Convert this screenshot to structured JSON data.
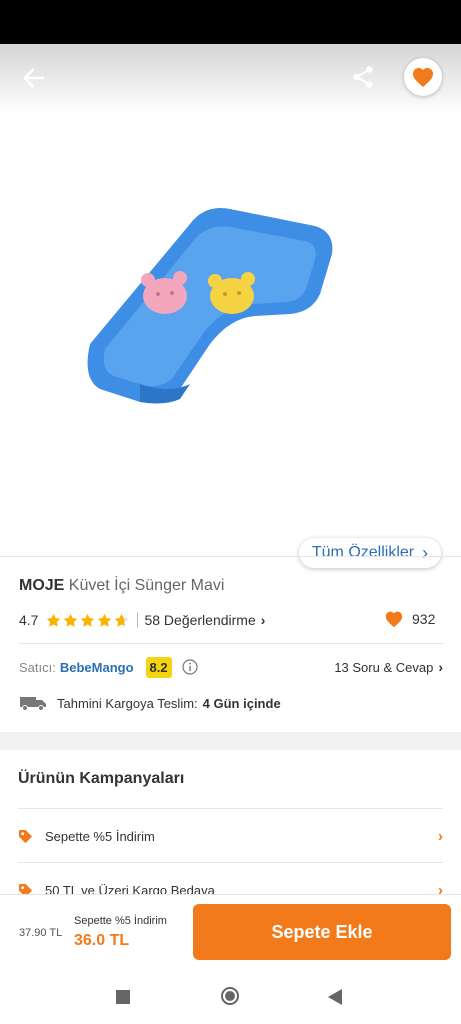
{
  "header": {
    "back_icon": "arrow-left-icon",
    "share_icon": "share-icon",
    "favorite_icon": "heart-icon"
  },
  "gallery": {
    "all_features_label": "Tüm Özellikler"
  },
  "product": {
    "brand": "MOJE",
    "name": "Küvet İçi Sünger Mavi",
    "rating": "4.7",
    "rating_value": 4.7,
    "reviews_label": "58 Değerlendirme",
    "likes": "932"
  },
  "seller": {
    "label": "Satıcı:",
    "name": "BebeMango",
    "score": "8.2",
    "qa_label": "13 Soru & Cevap"
  },
  "delivery": {
    "label": "Tahmini Kargoya Teslim:",
    "value": "4 Gün içinde"
  },
  "campaigns": {
    "title": "Ürünün Kampanyaları",
    "items": [
      {
        "label": "Sepette %5 İndirim"
      },
      {
        "label": "50 TL ve Üzeri Kargo Bedava"
      }
    ]
  },
  "checkout": {
    "old_price": "37.90 TL",
    "promo_label": "Sepette %5 İndirim",
    "new_price": "36.0 TL",
    "add_to_cart_label": "Sepete Ekle"
  },
  "colors": {
    "accent": "#f27a1a",
    "link": "#2b6fb6",
    "score_badge": "#f3d312"
  }
}
